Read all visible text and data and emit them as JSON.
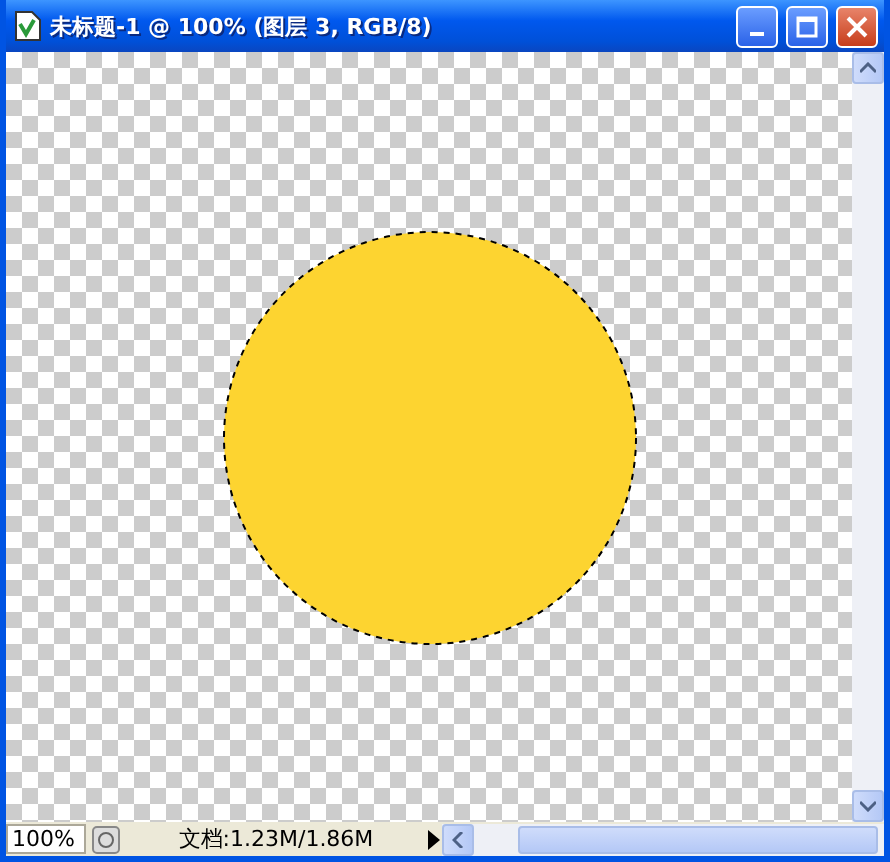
{
  "window": {
    "title": "未标题-1 @ 100% (图层 3, RGB/8)"
  },
  "status_bar": {
    "zoom": "100%",
    "document_size": "文档:1.23M/1.86M"
  }
}
